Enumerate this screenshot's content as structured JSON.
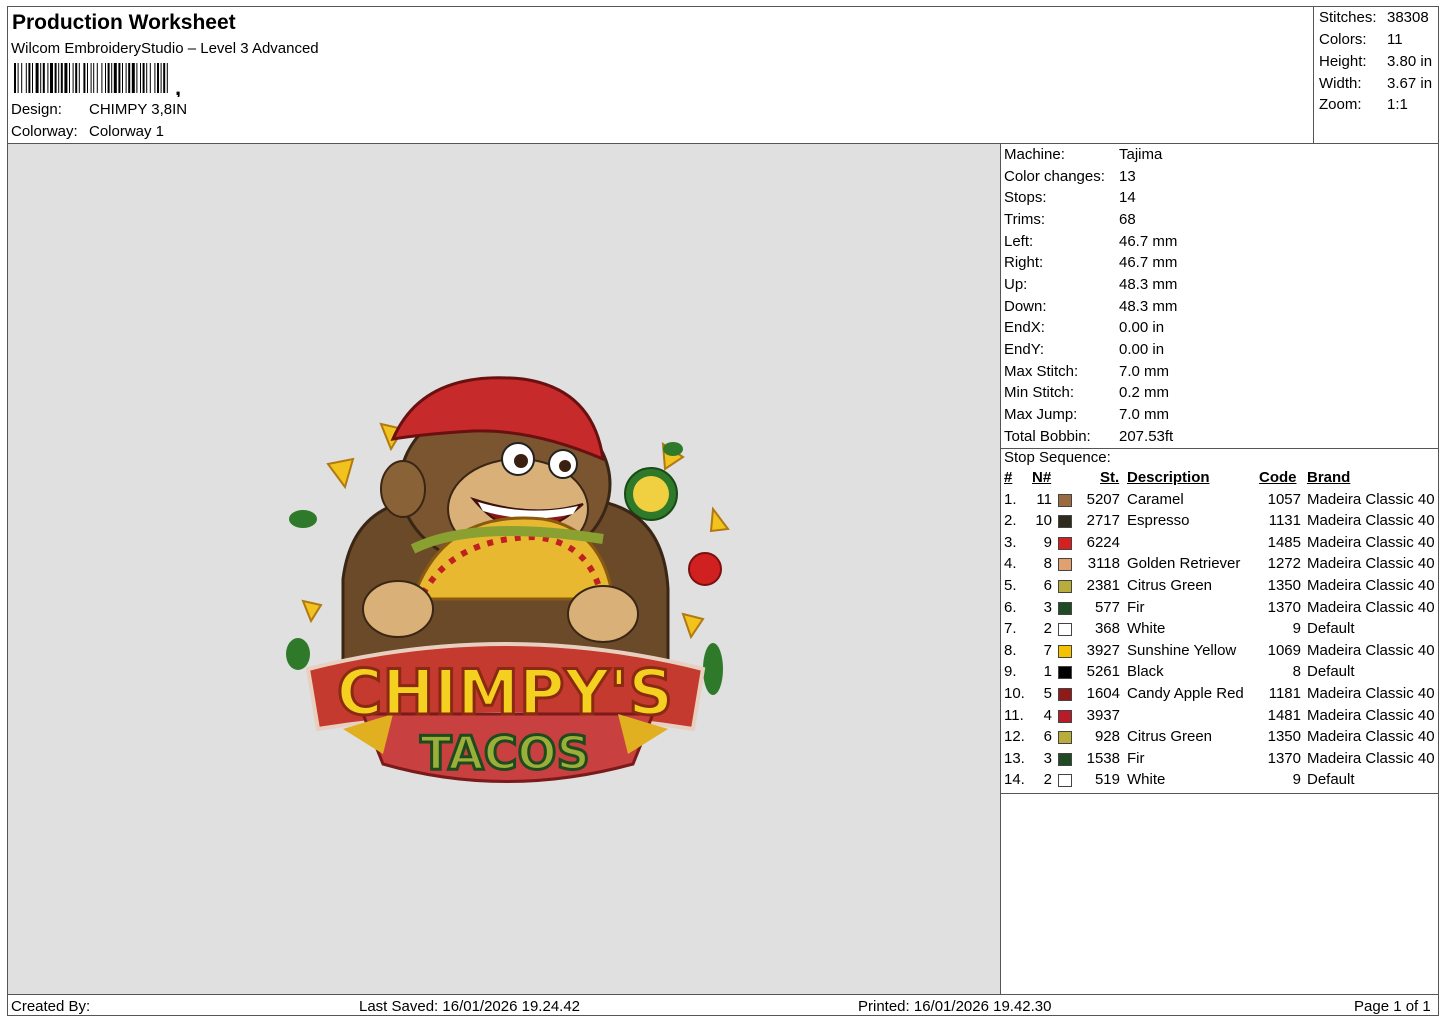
{
  "header": {
    "title": "Production Worksheet",
    "subtitle": "Wilcom EmbroideryStudio – Level 3 Advanced",
    "design_label": "Design:",
    "design_value": "CHIMPY 3,8IN",
    "colorway_label": "Colorway:",
    "colorway_value": "Colorway 1"
  },
  "stats": [
    {
      "label": "Stitches:",
      "value": "38308"
    },
    {
      "label": "Colors:",
      "value": "11"
    },
    {
      "label": "Height:",
      "value": "3.80 in"
    },
    {
      "label": "Width:",
      "value": "3.67 in"
    },
    {
      "label": "Zoom:",
      "value": "1:1"
    }
  ],
  "machine_info": [
    {
      "label": "Machine:",
      "value": "Tajima"
    },
    {
      "label": "Color changes:",
      "value": "13"
    },
    {
      "label": "Stops:",
      "value": "14"
    },
    {
      "label": "Trims:",
      "value": "68"
    },
    {
      "label": "Left:",
      "value": "46.7 mm"
    },
    {
      "label": "Right:",
      "value": "46.7 mm"
    },
    {
      "label": "Up:",
      "value": "48.3 mm"
    },
    {
      "label": "Down:",
      "value": "48.3 mm"
    },
    {
      "label": "EndX:",
      "value": "0.00 in"
    },
    {
      "label": "EndY:",
      "value": "0.00 in"
    },
    {
      "label": "Max Stitch:",
      "value": "7.0 mm"
    },
    {
      "label": "Min Stitch:",
      "value": "0.2 mm"
    },
    {
      "label": "Max Jump:",
      "value": "7.0 mm"
    },
    {
      "label": "Total Bobbin:",
      "value": "207.53ft"
    }
  ],
  "stop_sequence": {
    "title": "Stop Sequence:",
    "headers": {
      "idx": "#",
      "n": "N#",
      "st": "St.",
      "desc": "Description",
      "code": "Code",
      "brand": "Brand"
    },
    "rows": [
      {
        "idx": "1.",
        "n": "11",
        "color": "#9a6a40",
        "st": "5207",
        "desc": "Caramel",
        "code": "1057",
        "brand": "Madeira Classic 40"
      },
      {
        "idx": "2.",
        "n": "10",
        "color": "#2e2a1e",
        "st": "2717",
        "desc": "Espresso",
        "code": "1131",
        "brand": "Madeira Classic 40"
      },
      {
        "idx": "3.",
        "n": "9",
        "color": "#d42020",
        "st": "6224",
        "desc": "",
        "code": "1485",
        "brand": "Madeira Classic 40"
      },
      {
        "idx": "4.",
        "n": "8",
        "color": "#e0a070",
        "st": "3118",
        "desc": "Golden Retriever",
        "code": "1272",
        "brand": "Madeira Classic 40"
      },
      {
        "idx": "5.",
        "n": "6",
        "color": "#b8ac3a",
        "st": "2381",
        "desc": "Citrus Green",
        "code": "1350",
        "brand": "Madeira Classic 40"
      },
      {
        "idx": "6.",
        "n": "3",
        "color": "#1f4a24",
        "st": "577",
        "desc": "Fir",
        "code": "1370",
        "brand": "Madeira Classic 40"
      },
      {
        "idx": "7.",
        "n": "2",
        "color": "#ffffff",
        "st": "368",
        "desc": "White",
        "code": "9",
        "brand": "Default"
      },
      {
        "idx": "8.",
        "n": "7",
        "color": "#f4c200",
        "st": "3927",
        "desc": "Sunshine Yellow",
        "code": "1069",
        "brand": "Madeira Classic 40"
      },
      {
        "idx": "9.",
        "n": "1",
        "color": "#000000",
        "st": "5261",
        "desc": "Black",
        "code": "8",
        "brand": "Default"
      },
      {
        "idx": "10.",
        "n": "5",
        "color": "#8e1a1a",
        "st": "1604",
        "desc": "Candy Apple Red",
        "code": "1181",
        "brand": "Madeira Classic 40"
      },
      {
        "idx": "11.",
        "n": "4",
        "color": "#b81c28",
        "st": "3937",
        "desc": "",
        "code": "1481",
        "brand": "Madeira Classic 40"
      },
      {
        "idx": "12.",
        "n": "6",
        "color": "#b8ac3a",
        "st": "928",
        "desc": "Citrus Green",
        "code": "1350",
        "brand": "Madeira Classic 40"
      },
      {
        "idx": "13.",
        "n": "3",
        "color": "#1f4a24",
        "st": "1538",
        "desc": "Fir",
        "code": "1370",
        "brand": "Madeira Classic 40"
      },
      {
        "idx": "14.",
        "n": "2",
        "color": "#ffffff",
        "st": "519",
        "desc": "White",
        "code": "9",
        "brand": "Default"
      }
    ]
  },
  "logo": {
    "line1": "CHIMPY'S",
    "line2": "TACOS"
  },
  "footer": {
    "created_by": "Created By:",
    "last_saved": "Last Saved: 16/01/2026 19.24.42",
    "printed": "Printed: 16/01/2026 19.42.30",
    "page": "Page 1 of 1"
  }
}
